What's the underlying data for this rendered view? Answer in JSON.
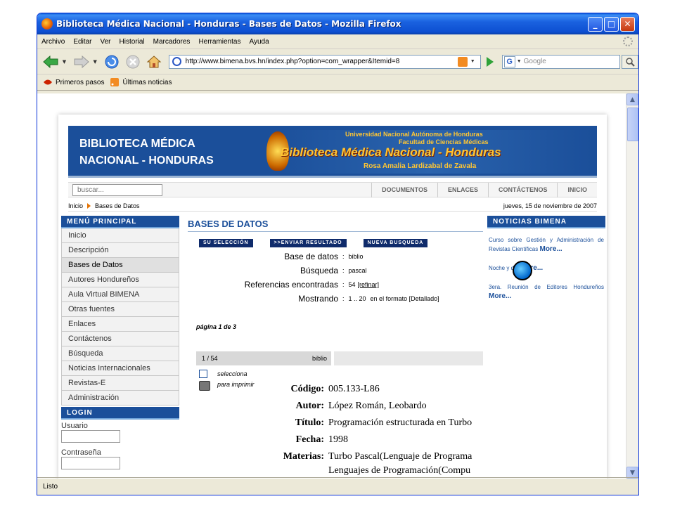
{
  "window": {
    "title": "Biblioteca Médica Nacional - Honduras - Bases de Datos - Mozilla Firefox"
  },
  "menubar": [
    "Archivo",
    "Editar",
    "Ver",
    "Historial",
    "Marcadores",
    "Herramientas",
    "Ayuda"
  ],
  "navbar": {
    "url": "http://www.bimena.bvs.hn/index.php?option=com_wrapper&Itemid=8",
    "search_placeholder": "Google",
    "search_engine_letter": "G"
  },
  "bookmarks": [
    "Primeros pasos",
    "Últimas noticias"
  ],
  "status": "Listo",
  "site": {
    "banner_line1": "BIBLIOTECA MÉDICA",
    "banner_line2": "NACIONAL - HONDURAS",
    "univ": "Universidad Nacional Autónoma de Honduras",
    "faculty": "Facultad de Ciencias Médicas",
    "main": "Biblioteca Médica Nacional - Honduras",
    "sub": "Rosa Amalia Lardizabal de Zavala",
    "search_placeholder": "buscar...",
    "topnav": [
      "DOCUMENTOS",
      "ENLACES",
      "CONTÁCTENOS",
      "INICIO"
    ],
    "breadcrumb": [
      "Inicio",
      "Bases de Datos"
    ],
    "date": "jueves, 15 de noviembre de 2007",
    "menu_title": "MENÚ PRINCIPAL",
    "menu": [
      "Inicio",
      "Descripción",
      "Bases de Datos",
      "Autores Hondureños",
      "Aula Virtual BIMENA",
      "Otras fuentes",
      "Enlaces",
      "Contáctenos",
      "Búsqueda",
      "Noticias Internacionales",
      "Revistas-E",
      "Administración"
    ],
    "active_menu_index": 2,
    "login_title": "LOGIN",
    "login_user": "Usuario",
    "login_pass": "Contraseña",
    "main_title": "BASES DE DATOS",
    "actions": [
      "SU SELECCIÓN",
      ">>ENVIAR RESULTADO",
      "NUEVA BUSQUEDA"
    ],
    "query": [
      {
        "k": "Base de datos",
        "v": "biblio"
      },
      {
        "k": "Búsqueda",
        "v": "pascal"
      },
      {
        "k": "Referencias encontradas",
        "v": "54",
        "link": "[refinar]"
      },
      {
        "k": "Mostrando",
        "v": "1 .. 20",
        "extra": "en el formato [Detallado]"
      }
    ],
    "pagina": "página 1 de 3",
    "result_index": "1 / 54",
    "result_db": "biblio",
    "select_label": "selecciona",
    "print_label": "para imprimir",
    "record": [
      {
        "k": "Código:",
        "v": "005.133-L86"
      },
      {
        "k": "Autor:",
        "v": "López Román, Leobardo"
      },
      {
        "k": "Título:",
        "v": "Programación estructurada en Turbo"
      },
      {
        "k": "Fecha:",
        "v": "1998"
      },
      {
        "k": "Materias:",
        "v": "Turbo Pascal(Lenguaje de Programa"
      },
      {
        "k": "",
        "v": "Lenguajes de Programación(Compu"
      }
    ],
    "news_title": "NOTICIAS BIMENA",
    "news": [
      {
        "text": "Curso sobre Gestión y Administración de Revistas Científicas",
        "more": "More..."
      },
      {
        "text": "Noche y día",
        "more": "More..."
      },
      {
        "text": "3era. Reunión de Editores Hondureños",
        "more": "More..."
      }
    ]
  }
}
